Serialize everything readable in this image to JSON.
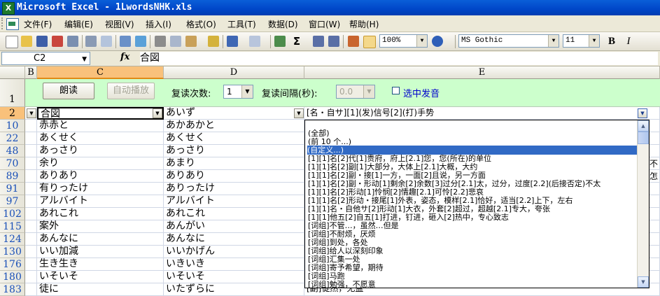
{
  "window": {
    "title": "Microsoft Excel - 1LwordsNHK.xls"
  },
  "menu": [
    "文件(F)",
    "编辑(E)",
    "视图(V)",
    "插入(I)",
    "格式(O)",
    "工具(T)",
    "数据(D)",
    "窗口(W)",
    "帮助(H)"
  ],
  "toolbar": {
    "zoom": "100%",
    "font": "MS Gothic",
    "size": "11",
    "bold": "B",
    "italic": "I"
  },
  "formula_bar": {
    "cell_ref": "C2",
    "fx": "fx",
    "content": "合図"
  },
  "columns": [
    "B",
    "C",
    "D",
    "E"
  ],
  "controls": {
    "read_label": "朗读",
    "autoplay_label": "自动播放",
    "repeat_count_label": "复读次数:",
    "repeat_count_value": "1",
    "repeat_interval_label": "复读间隔(秒):",
    "repeat_interval_value": "0.0",
    "select_sound_label": "选中发音"
  },
  "header_row": {
    "row": "2",
    "c": "合図",
    "d": "あいず",
    "e": "[名・自サ][1](发)信号[2](打)手势"
  },
  "row1_num": "1",
  "rows": [
    {
      "num": "10",
      "c": "赤赤と",
      "d": "あかあかと"
    },
    {
      "num": "22",
      "c": "あくせく",
      "d": "あくせく"
    },
    {
      "num": "48",
      "c": "あっさり",
      "d": "あっさり"
    },
    {
      "num": "70",
      "c": "余り",
      "d": "あまり"
    },
    {
      "num": "89",
      "c": "ありあり",
      "d": "ありあり"
    },
    {
      "num": "91",
      "c": "有りったけ",
      "d": "ありったけ"
    },
    {
      "num": "97",
      "c": "アルバイト",
      "d": "アルバイト"
    },
    {
      "num": "102",
      "c": "あれこれ",
      "d": "あれこれ"
    },
    {
      "num": "115",
      "c": "案外",
      "d": "あんがい"
    },
    {
      "num": "124",
      "c": "あんなに",
      "d": "あんなに"
    },
    {
      "num": "130",
      "c": "いい加減",
      "d": "いいかげん"
    },
    {
      "num": "176",
      "c": "生き生き",
      "d": "いきいき"
    },
    {
      "num": "180",
      "c": "いそいそ",
      "d": "いそいそ"
    },
    {
      "num": "183",
      "c": "徒に",
      "d": "いたずらに"
    }
  ],
  "e_overflow": {
    "r70": "不怎",
    "r183": "[副]徒然，无益"
  },
  "dropdown_items": [
    "(全部)",
    "(前 10 个...)",
    "(自定义...)",
    "[1][1]名[2]代[1]贵府，府上[2.1]您，您(所在)的单位",
    "[1][1]名[2]副[1]大部分，大体上[2.1]大概，大约",
    "[1][1]名[2]副・接[1]一方，一面[2]且说，另一方面",
    "[1][1]名[2]副・形动[1]剩余[2]余数[3]过分[2.1]太，过分，过度[2.2](后接否定)不太",
    "[1][1]名[2]形动[1]怜悯[2]情趣[2.1]可怜[2.2]悲哀",
    "[1][1]名[2]形动・接尾[1]外表，姿态，模样[2.1]恰好，适当[2.2]上下，左右",
    "[1][1]名・自他サ[2]形动[1]大衣，外套[2]超过，超越[2.1]专大，夸张",
    "[1][1]他五[2]自五[1]打进，钉进，砸入[2]热中，专心致志",
    "[词组]不管…，虽然…但是",
    "[词组]不耐烦，厌烦",
    "[词组]到处，各处",
    "[词组]给人以深刻印象",
    "[词组]汇集一处",
    "[词组]寄予希望，期待",
    "[词组]马跑",
    "[词组]勉强，不愿意"
  ],
  "colors": {
    "title_bar": "#0046c8",
    "control_row": "#ccffcc",
    "selection": "#316ac5",
    "row_number": "#1a50b8"
  }
}
